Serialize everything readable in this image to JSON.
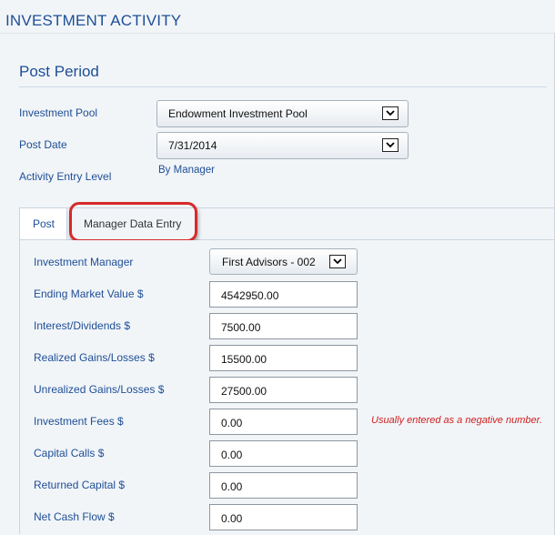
{
  "app": {
    "title": "INVESTMENT ACTIVITY"
  },
  "post_period": {
    "title": "Post Period",
    "investment_pool": {
      "label": "Investment Pool",
      "value": "Endowment Investment Pool"
    },
    "post_date": {
      "label": "Post Date",
      "value": "7/31/2014"
    },
    "activity_entry_level": {
      "label": "Activity Entry Level",
      "value": "By Manager"
    }
  },
  "tabs": [
    {
      "label": "Post"
    },
    {
      "label": "Manager Data Entry"
    }
  ],
  "manager_entry": {
    "investment_manager": {
      "label": "Investment Manager",
      "value": "First Advisors - 002"
    },
    "fields": [
      {
        "label": "Ending Market Value $",
        "value": "4542950.00"
      },
      {
        "label": "Interest/Dividends $",
        "value": "7500.00"
      },
      {
        "label": "Realized Gains/Losses $",
        "value": "15500.00"
      },
      {
        "label": "Unrealized Gains/Losses $",
        "value": "27500.00"
      },
      {
        "label": "Investment Fees $",
        "value": "0.00"
      },
      {
        "label": "Capital Calls $",
        "value": "0.00"
      },
      {
        "label": "Returned Capital $",
        "value": "0.00"
      },
      {
        "label": "Net Cash Flow $",
        "value": "0.00"
      }
    ],
    "fees_hint": "Usually entered as a negative number."
  },
  "colors": {
    "accent": "#1f4e96",
    "highlight": "#d62a2a",
    "hint": "#d22020"
  },
  "icons": {
    "dropdown": "chevron-down-icon"
  }
}
